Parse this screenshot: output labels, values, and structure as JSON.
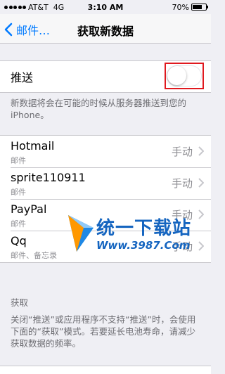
{
  "status_bar": {
    "carrier": "AT&T",
    "network": "4G",
    "time": "3:10 AM",
    "battery_percent": "70%",
    "battery_level": 0.7
  },
  "nav": {
    "back_label": "邮件…",
    "title": "获取新数据"
  },
  "push": {
    "label": "推送",
    "enabled": false,
    "footnote": "新数据将会在可能的时候从服务器推送到您的iPhone。"
  },
  "accounts": [
    {
      "name": "Hotmail",
      "subtitle": "邮件",
      "value": "手动"
    },
    {
      "name": "sprite110911",
      "subtitle": "邮件",
      "value": "手动"
    },
    {
      "name": "PayPal",
      "subtitle": "邮件",
      "value": "手动"
    },
    {
      "name": "Qq",
      "subtitle": "邮件、备忘录",
      "value": "手动"
    }
  ],
  "fetch": {
    "header": "获取",
    "footnote": "关闭“推送”或应用程序不支持“推送”时，会使用下面的“获取”模式。若要延长电池寿命，请减少获取数据的频率。"
  },
  "watermark": {
    "title": "统一下载站",
    "url": "Www.3987.Com"
  },
  "colors": {
    "accent": "#007aff",
    "highlight_box": "#e0191f",
    "background": "#efeff4",
    "watermark": "#1565c0"
  }
}
